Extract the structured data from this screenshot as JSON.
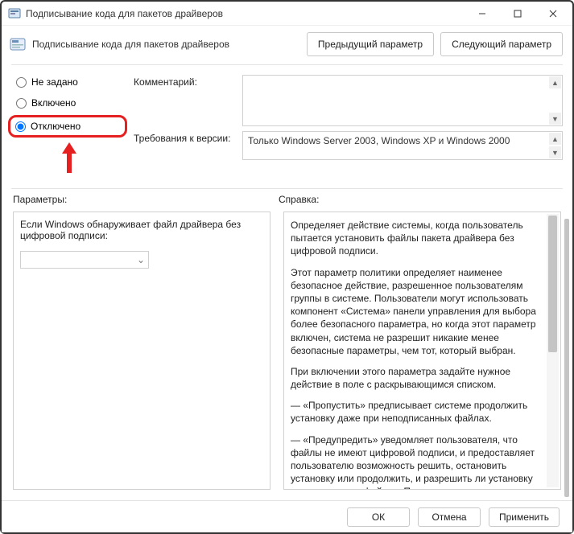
{
  "titlebar": {
    "title": "Подписывание кода для пакетов драйверов"
  },
  "header": {
    "text": "Подписывание кода для пакетов драйверов",
    "prev": "Предыдущий параметр",
    "next": "Следующий параметр"
  },
  "radios": {
    "not_configured": "Не задано",
    "enabled": "Включено",
    "disabled": "Отключено",
    "selected": "disabled"
  },
  "labels": {
    "comment": "Комментарий:",
    "requirements": "Требования к версии:",
    "parameters": "Параметры:",
    "help": "Справка:"
  },
  "requirements_value": "Только Windows Server 2003, Windows XP и Windows 2000",
  "param_text": "Если Windows обнаруживает файл драйвера без цифровой подписи:",
  "help_text": {
    "p1": "Определяет действие системы, когда пользователь пытается установить файлы пакета драйвера без цифровой подписи.",
    "p2": "Этот параметр политики определяет наименее безопасное действие, разрешенное пользователям группы в системе. Пользователи могут использовать компонент «Система» панели управления для выбора более безопасного параметра, но когда этот параметр включен, система не разрешит никакие менее безопасные параметры, чем тот, который выбран.",
    "p3": "При включении этого параметра задайте нужное действие в поле с раскрывающимся списком.",
    "p4": "—   «Пропустить» предписывает системе продолжить установку даже при неподписанных файлах.",
    "p5": "—   «Предупредить» уведомляет пользователя, что файлы не имеют цифровой подписи, и предоставляет пользователю возможность решить, остановить установку или продолжить, и разрешить ли установку неподписанных файлов. Параметр"
  },
  "footer": {
    "ok": "ОК",
    "cancel": "Отмена",
    "apply": "Применить"
  }
}
